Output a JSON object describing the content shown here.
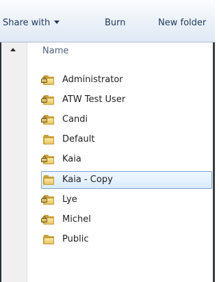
{
  "toolbar": {
    "share_label": "Share with",
    "burn_label": "Burn",
    "new_folder_label": "New folder"
  },
  "column_header": {
    "name": "Name"
  },
  "folders": [
    {
      "name": "Administrator",
      "locked": true,
      "selected": false
    },
    {
      "name": "ATW Test User",
      "locked": true,
      "selected": false
    },
    {
      "name": "Candi",
      "locked": true,
      "selected": false
    },
    {
      "name": "Default",
      "locked": false,
      "selected": false
    },
    {
      "name": "Kaia",
      "locked": true,
      "selected": false
    },
    {
      "name": "Kaia - Copy",
      "locked": false,
      "selected": true
    },
    {
      "name": "Lye",
      "locked": true,
      "selected": false
    },
    {
      "name": "Michel",
      "locked": true,
      "selected": false
    },
    {
      "name": "Public",
      "locked": false,
      "selected": false
    }
  ],
  "colors": {
    "toolbar_text": "#1e395b",
    "selection_border": "#7da2ce",
    "folder": "#e8c464"
  },
  "icons": [
    "dropdown-arrow-icon",
    "scroll-up-arrow-icon",
    "folder-icon",
    "lock-icon"
  ]
}
